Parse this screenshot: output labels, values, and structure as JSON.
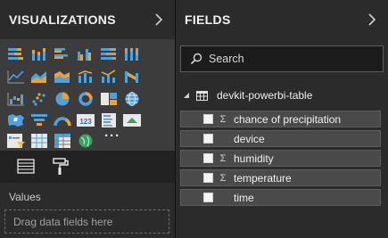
{
  "visualizations": {
    "title": "VISUALIZATIONS",
    "values_label": "Values",
    "drop_placeholder": "Drag data fields here",
    "more_label": "···"
  },
  "fields": {
    "title": "FIELDS",
    "search_placeholder": "Search",
    "table_name": "devkit-powerbi-table",
    "items": [
      {
        "label": "chance of precipitation",
        "aggregate": "Σ"
      },
      {
        "label": "device",
        "aggregate": ""
      },
      {
        "label": "humidity",
        "aggregate": "Σ"
      },
      {
        "label": "temperature",
        "aggregate": "Σ"
      },
      {
        "label": "time",
        "aggregate": ""
      }
    ]
  },
  "colors": {
    "background": "#2b2b2b",
    "icon_well": "#3c3c3c",
    "accent_yellow": "#f2c811",
    "icon_blue": "#4aa3df",
    "icon_orange": "#f0a030"
  }
}
